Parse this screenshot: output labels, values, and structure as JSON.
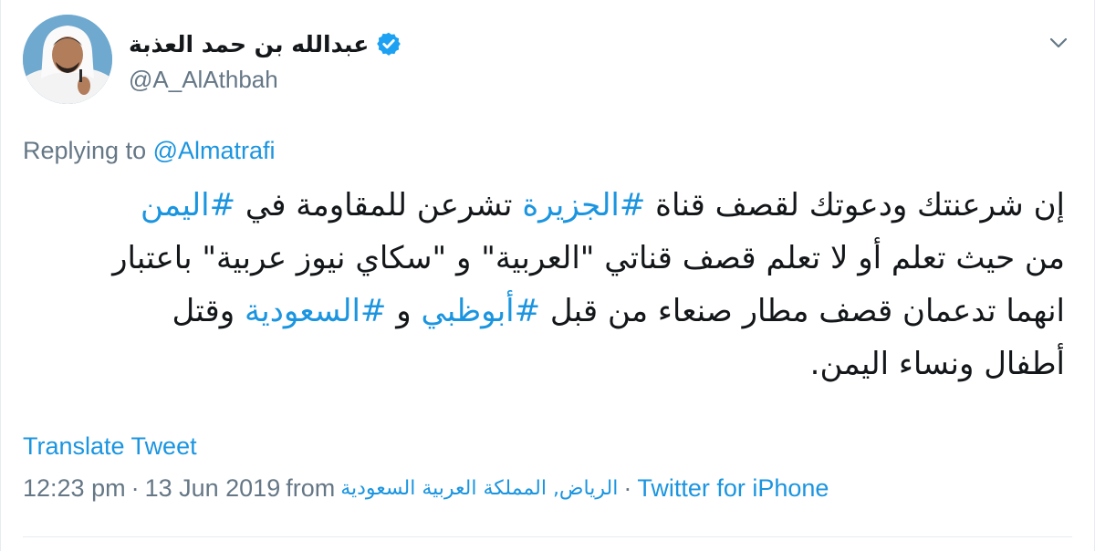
{
  "user": {
    "display_name": "عبدالله بن حمد العذبة",
    "handle": "@A_AlAthbah",
    "verified_icon": "verified-badge-icon",
    "avatar_icon": "avatar"
  },
  "reply": {
    "prefix": "Replying to ",
    "to": "@Almatrafi"
  },
  "tweet": {
    "line1": {
      "a": "إن شرعنتك ودعوتك لقصف قناة ",
      "h1": "#الجزيرة",
      "b": " تشرعن للمقاومة في ",
      "h2": "#اليمن"
    },
    "line2": "من حيث تعلم أو لا تعلم قصف قناتي \"العربية\" و \"سكاي نيوز عربية\" باعتبار",
    "line3": {
      "a": "انهما تدعمان قصف مطار صنعاء من قبل ",
      "h1": "#أبوظبي",
      "b": " و ",
      "h2": "#السعودية",
      "c": " وقتل"
    },
    "line4": "أطفال ونساء اليمن."
  },
  "actions": {
    "translate": "Translate Tweet"
  },
  "meta": {
    "time": "12:23 pm",
    "sep1": "·",
    "date": "13 Jun 2019",
    "from": "from",
    "place": "الرياض, المملكة العربية السعودية",
    "sep2": "·",
    "source": "Twitter for iPhone"
  },
  "colors": {
    "link": "#1b95e0",
    "secondary": "#657786",
    "text": "#14171a"
  }
}
